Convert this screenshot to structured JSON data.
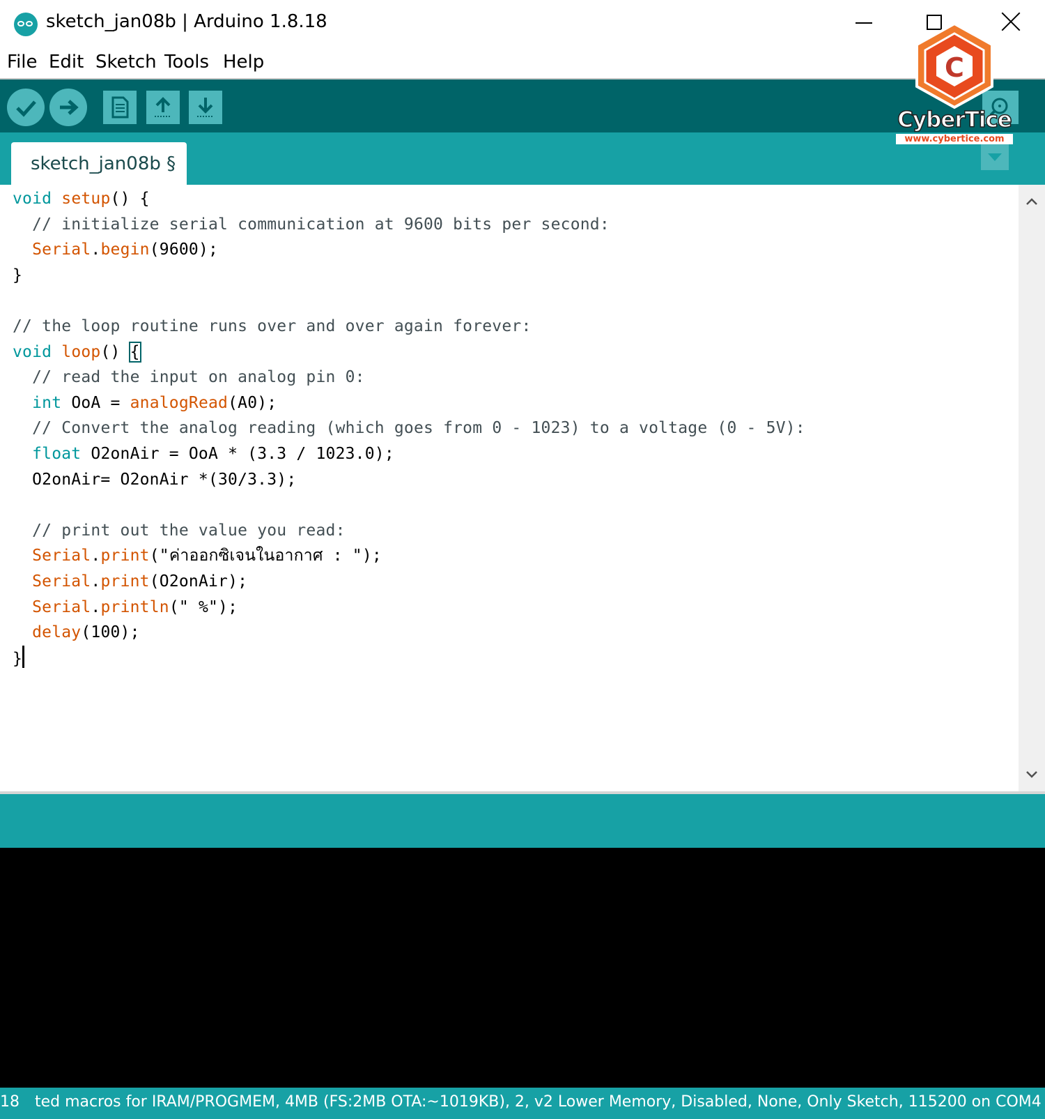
{
  "window": {
    "title": "sketch_jan08b | Arduino 1.8.18",
    "app_icon": "arduino-logo-icon",
    "controls": [
      "minimize-icon",
      "maximize-icon",
      "close-icon"
    ]
  },
  "menu": {
    "items": [
      "File",
      "Edit",
      "Sketch",
      "Tools",
      "Help"
    ]
  },
  "toolbar": {
    "buttons": [
      {
        "icon": "checkmark-icon",
        "action": "Verify"
      },
      {
        "icon": "arrow-right-icon",
        "action": "Upload"
      },
      {
        "icon": "document-icon",
        "action": "New"
      },
      {
        "icon": "arrow-up-icon",
        "action": "Open"
      },
      {
        "icon": "arrow-down-icon",
        "action": "Save"
      },
      {
        "icon": "magnifier-icon",
        "action": "Serial Monitor"
      }
    ]
  },
  "tabs": {
    "active_label": "sketch_jan08b §",
    "menu_icon": "triangle-down-icon"
  },
  "editor": {
    "lines": [
      "void setup() {",
      "  // initialize serial communication at 9600 bits per second:",
      "  Serial.begin(9600);",
      "}",
      "",
      "// the loop routine runs over and over again forever:",
      "void loop() {",
      "  // read the input on analog pin 0:",
      "  int OoA = analogRead(A0);",
      "  // Convert the analog reading (which goes from 0 - 1023) to a voltage (0 - 5V):",
      "  float O2onAir = OoA * (3.3 / 1023.0);",
      "  O2onAir= O2onAir *(30/3.3);",
      "",
      "  // print out the value you read:",
      "  Serial.print(\"ค่าออกซิเจนในอากาศ : \");",
      "  Serial.print(O2onAir);",
      "  Serial.println(\" %\");",
      "  delay(100);",
      "}"
    ]
  },
  "scrollbar": {
    "up_icon": "chevron-up-icon",
    "down_icon": "chevron-down-icon"
  },
  "status": {
    "line_number": "18",
    "board_info": "ted macros for IRAM/PROGMEM, 4MB (FS:2MB OTA:~1019KB), 2, v2 Lower Memory, Disabled, None, Only Sketch, 115200 on COM4"
  },
  "watermark": {
    "brand": "CyberTice",
    "url": "www.cybertice.com",
    "letter": "C"
  },
  "colors": {
    "toolbar": "#006468",
    "accent": "#17a1a5",
    "button": "#4db7bb",
    "keyword": "#00979c",
    "function": "#d35400",
    "console": "#000000"
  }
}
